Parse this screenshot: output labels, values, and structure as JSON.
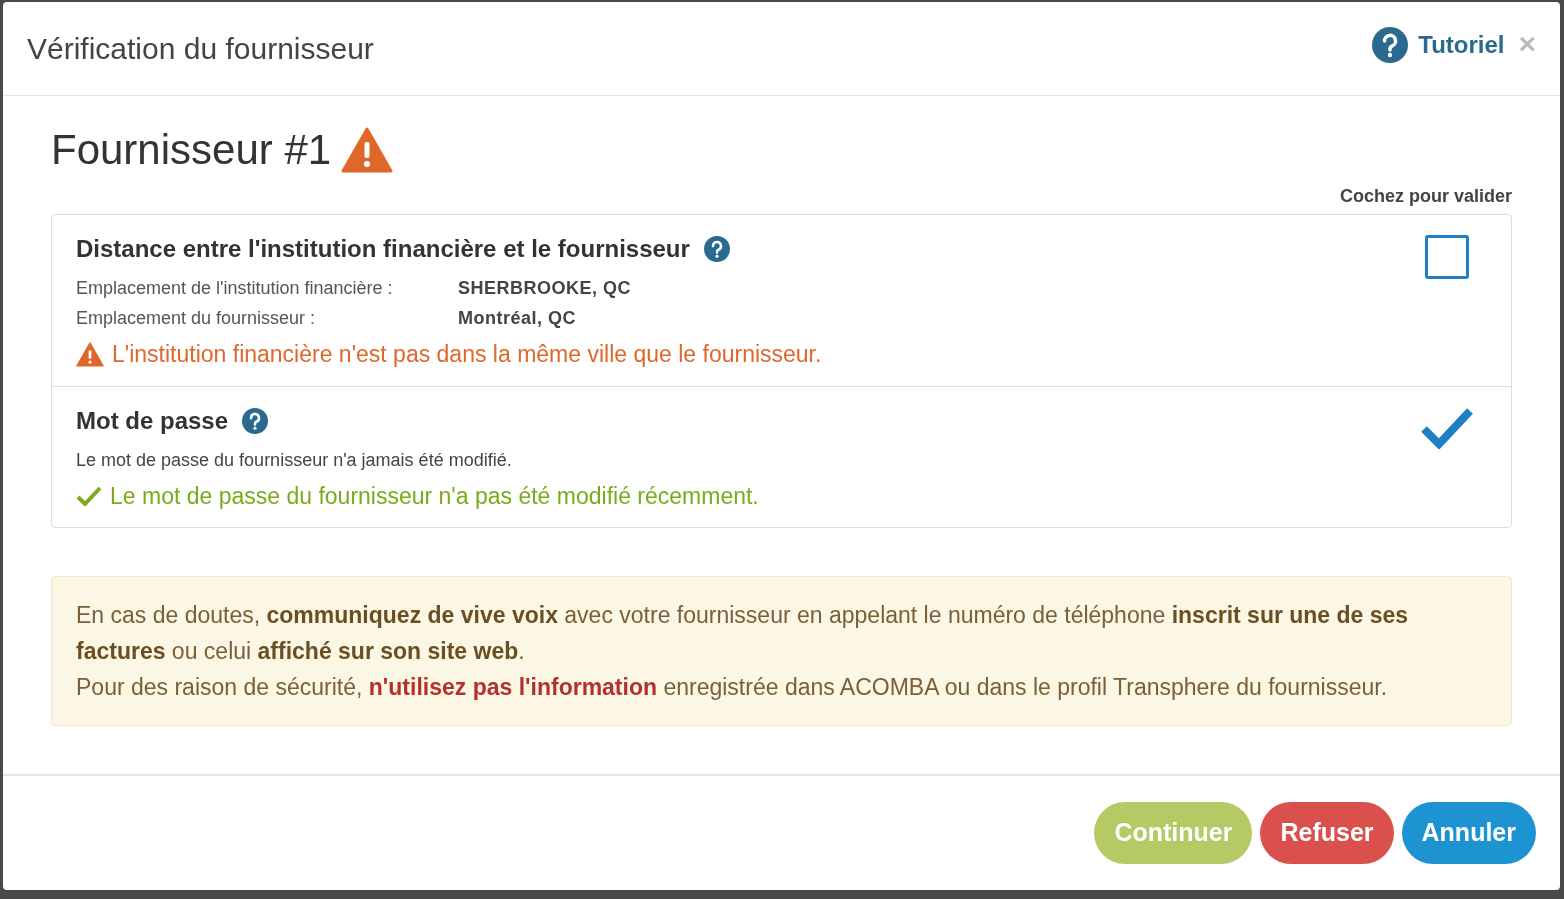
{
  "dialog": {
    "title": "Vérification du fournisseur",
    "tutorial_label": "Tutoriel",
    "close_label": "×"
  },
  "supplier": {
    "heading": "Fournisseur #1",
    "warning": true
  },
  "checks_header": "Cochez pour valider",
  "checks": [
    {
      "title": "Distance entre l'institution financière et le fournisseur",
      "details": [
        {
          "label": "Emplacement de l'institution financière :",
          "value": "SHERBROOKE, QC"
        },
        {
          "label": "Emplacement du fournisseur :",
          "value": "Montréal, QC"
        }
      ],
      "status": {
        "kind": "warning",
        "text": "L'institution financière n'est pas dans la même ville que le fournisseur."
      },
      "checked": false
    },
    {
      "title": "Mot de passe",
      "description": "Le mot de passe du fournisseur n'a jamais été modifié.",
      "status": {
        "kind": "success",
        "text": "Le mot de passe du fournisseur n'a pas été modifié récemment."
      },
      "checked": true
    }
  ],
  "notice": [
    [
      {
        "kind": "plain",
        "text": "En cas de doutes, "
      },
      {
        "kind": "bold",
        "text": "communiquez de vive voix"
      },
      {
        "kind": "plain",
        "text": " avec votre fournisseur en appelant le numéro de téléphone "
      },
      {
        "kind": "bold",
        "text": "inscrit sur une de ses factures"
      },
      {
        "kind": "plain",
        "text": " ou celui "
      },
      {
        "kind": "bold",
        "text": "affiché sur son site web"
      },
      {
        "kind": "plain",
        "text": "."
      }
    ],
    [
      {
        "kind": "plain",
        "text": "Pour des raison de sécurité, "
      },
      {
        "kind": "alert",
        "text": "n'utilisez pas l'information"
      },
      {
        "kind": "plain",
        "text": " enregistrée dans ACOMBA ou dans le profil Transphere du fournisseur."
      }
    ]
  ],
  "buttons": [
    {
      "label": "Continuer",
      "kind": "continue"
    },
    {
      "label": "Refuser",
      "kind": "refuse"
    },
    {
      "label": "Annuler",
      "kind": "cancel"
    }
  ]
}
